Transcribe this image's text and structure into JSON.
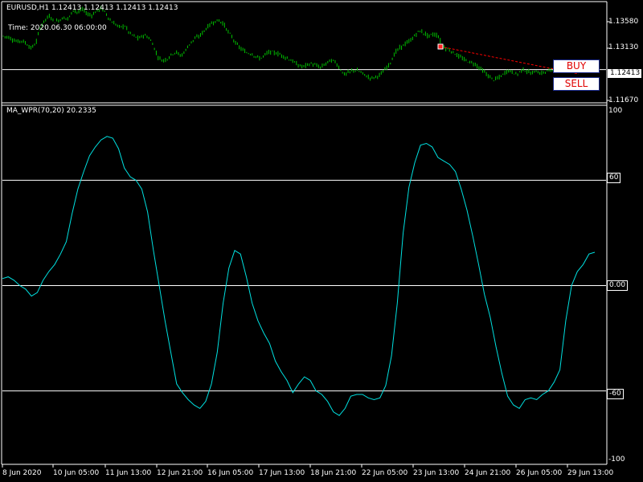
{
  "window": {
    "symbol_header": "EURUSD,H1  1.12413 1.12413 1.12413 1.12413",
    "time_readout": "Time: 2020.06.30 06:00:00"
  },
  "trade_panel": {
    "buy_label": "BUY",
    "sell_label": "SELL"
  },
  "price_pane": {
    "price_labels": [
      "1.13580",
      "1.13130",
      "1.11670"
    ],
    "current_price": "1.12413",
    "candle_color": "#00c000",
    "grid_color": "#ffffff",
    "trend_line_color": "#ff0000"
  },
  "indicator_pane": {
    "header": "MA_WPR(70,20) 20.2335",
    "levels": [
      "100",
      "60",
      "0.00",
      "-60",
      "-100"
    ],
    "line_color": "#00e0e0"
  },
  "x_axis": {
    "labels": [
      "8 Jun 2020",
      "10 Jun 05:00",
      "11 Jun 13:00",
      "12 Jun 21:00",
      "16 Jun 05:00",
      "17 Jun 13:00",
      "18 Jun 21:00",
      "22 Jun 05:00",
      "23 Jun 13:00",
      "24 Jun 21:00",
      "26 Jun 05:00",
      "29 Jun 13:00"
    ]
  },
  "chart_data": [
    {
      "type": "candlestick",
      "ylim": [
        1.1167,
        1.1395
      ],
      "y_ticks": [
        1.1358,
        1.1313,
        1.1167
      ],
      "close_path": [
        1.1318,
        1.1316,
        1.131,
        1.1305,
        1.1308,
        1.13,
        1.129,
        1.1302,
        1.134,
        1.1356,
        1.1364,
        1.135,
        1.1355,
        1.136,
        1.1358,
        1.1378,
        1.1372,
        1.138,
        1.1368,
        1.1366,
        1.1375,
        1.1382,
        1.137,
        1.1352,
        1.1345,
        1.1338,
        1.1342,
        1.1325,
        1.1318,
        1.1312,
        1.132,
        1.1316,
        1.13,
        1.1272,
        1.1262,
        1.1265,
        1.1276,
        1.1282,
        1.1272,
        1.1285,
        1.1302,
        1.1312,
        1.1318,
        1.133,
        1.1342,
        1.135,
        1.1354,
        1.1348,
        1.133,
        1.1315,
        1.1298,
        1.1288,
        1.128,
        1.1278,
        1.1272,
        1.1266,
        1.1275,
        1.1282,
        1.128,
        1.1277,
        1.1272,
        1.1266,
        1.126,
        1.1252,
        1.1248,
        1.1252,
        1.1255,
        1.125,
        1.1246,
        1.1255,
        1.1262,
        1.126,
        1.1244,
        1.123,
        1.1235,
        1.124,
        1.1238,
        1.1232,
        1.1224,
        1.1222,
        1.1226,
        1.1232,
        1.1245,
        1.126,
        1.1282,
        1.1292,
        1.13,
        1.1306,
        1.1318,
        1.133,
        1.1325,
        1.1318,
        1.1322,
        1.132,
        1.1295,
        1.1288,
        1.1283,
        1.1275,
        1.1268,
        1.1262,
        1.1258,
        1.1254,
        1.1245,
        1.1235,
        1.1225,
        1.1218,
        1.1222,
        1.123,
        1.124,
        1.1235,
        1.123,
        1.1242,
        1.1238,
        1.1232,
        1.1238,
        1.1232,
        1.1236,
        1.124,
        1.1241
      ]
    },
    {
      "type": "line",
      "series_name": "MA_WPR(70,20)",
      "ylim": [
        -100,
        100
      ],
      "levels": [
        100,
        60,
        0,
        -60,
        -100
      ],
      "y": [
        4,
        5,
        3,
        0,
        -2,
        -6,
        -4,
        3,
        8,
        12,
        18,
        25,
        41,
        55,
        65,
        74,
        79,
        83,
        85,
        84,
        78,
        67,
        62,
        60,
        55,
        42,
        20,
        0,
        -20,
        -38,
        -56,
        -61,
        -65,
        -68,
        -70,
        -66,
        -56,
        -38,
        -10,
        10,
        20,
        18,
        5,
        -10,
        -20,
        -27,
        -33,
        -43,
        -49,
        -54,
        -61,
        -56,
        -52,
        -54,
        -60,
        -62,
        -66,
        -72,
        -74,
        -70,
        -63,
        -62,
        -62,
        -64,
        -65,
        -64,
        -57,
        -40,
        -10,
        30,
        56,
        70,
        80,
        81,
        79,
        73,
        71,
        69,
        65,
        55,
        43,
        28,
        12,
        -5,
        -18,
        -35,
        -50,
        -63,
        -68,
        -70,
        -65,
        -64,
        -65,
        -62,
        -60,
        -55,
        -48,
        -20,
        0,
        8,
        12,
        18,
        19
      ]
    }
  ]
}
